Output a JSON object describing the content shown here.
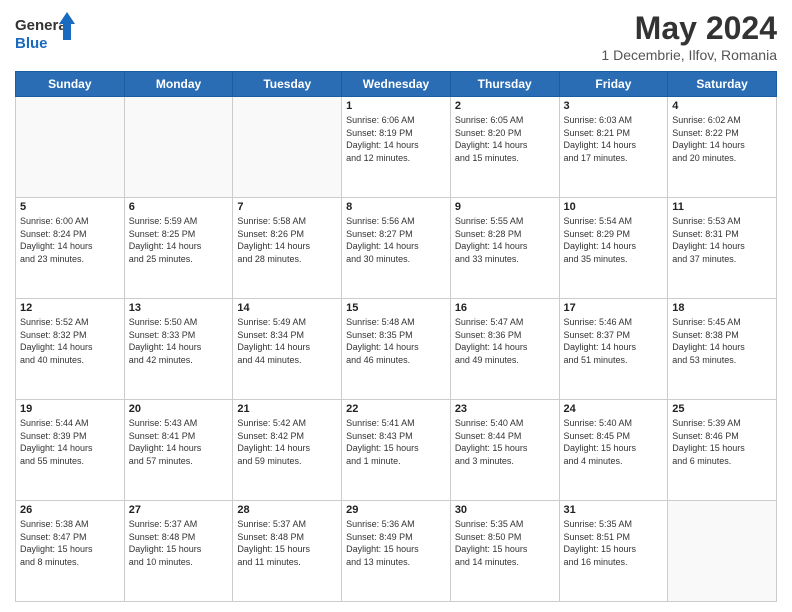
{
  "logo": {
    "line1": "General",
    "line2": "Blue"
  },
  "title": "May 2024",
  "subtitle": "1 Decembrie, Ilfov, Romania",
  "weekdays": [
    "Sunday",
    "Monday",
    "Tuesday",
    "Wednesday",
    "Thursday",
    "Friday",
    "Saturday"
  ],
  "weeks": [
    [
      {
        "day": "",
        "info": ""
      },
      {
        "day": "",
        "info": ""
      },
      {
        "day": "",
        "info": ""
      },
      {
        "day": "1",
        "info": "Sunrise: 6:06 AM\nSunset: 8:19 PM\nDaylight: 14 hours\nand 12 minutes."
      },
      {
        "day": "2",
        "info": "Sunrise: 6:05 AM\nSunset: 8:20 PM\nDaylight: 14 hours\nand 15 minutes."
      },
      {
        "day": "3",
        "info": "Sunrise: 6:03 AM\nSunset: 8:21 PM\nDaylight: 14 hours\nand 17 minutes."
      },
      {
        "day": "4",
        "info": "Sunrise: 6:02 AM\nSunset: 8:22 PM\nDaylight: 14 hours\nand 20 minutes."
      }
    ],
    [
      {
        "day": "5",
        "info": "Sunrise: 6:00 AM\nSunset: 8:24 PM\nDaylight: 14 hours\nand 23 minutes."
      },
      {
        "day": "6",
        "info": "Sunrise: 5:59 AM\nSunset: 8:25 PM\nDaylight: 14 hours\nand 25 minutes."
      },
      {
        "day": "7",
        "info": "Sunrise: 5:58 AM\nSunset: 8:26 PM\nDaylight: 14 hours\nand 28 minutes."
      },
      {
        "day": "8",
        "info": "Sunrise: 5:56 AM\nSunset: 8:27 PM\nDaylight: 14 hours\nand 30 minutes."
      },
      {
        "day": "9",
        "info": "Sunrise: 5:55 AM\nSunset: 8:28 PM\nDaylight: 14 hours\nand 33 minutes."
      },
      {
        "day": "10",
        "info": "Sunrise: 5:54 AM\nSunset: 8:29 PM\nDaylight: 14 hours\nand 35 minutes."
      },
      {
        "day": "11",
        "info": "Sunrise: 5:53 AM\nSunset: 8:31 PM\nDaylight: 14 hours\nand 37 minutes."
      }
    ],
    [
      {
        "day": "12",
        "info": "Sunrise: 5:52 AM\nSunset: 8:32 PM\nDaylight: 14 hours\nand 40 minutes."
      },
      {
        "day": "13",
        "info": "Sunrise: 5:50 AM\nSunset: 8:33 PM\nDaylight: 14 hours\nand 42 minutes."
      },
      {
        "day": "14",
        "info": "Sunrise: 5:49 AM\nSunset: 8:34 PM\nDaylight: 14 hours\nand 44 minutes."
      },
      {
        "day": "15",
        "info": "Sunrise: 5:48 AM\nSunset: 8:35 PM\nDaylight: 14 hours\nand 46 minutes."
      },
      {
        "day": "16",
        "info": "Sunrise: 5:47 AM\nSunset: 8:36 PM\nDaylight: 14 hours\nand 49 minutes."
      },
      {
        "day": "17",
        "info": "Sunrise: 5:46 AM\nSunset: 8:37 PM\nDaylight: 14 hours\nand 51 minutes."
      },
      {
        "day": "18",
        "info": "Sunrise: 5:45 AM\nSunset: 8:38 PM\nDaylight: 14 hours\nand 53 minutes."
      }
    ],
    [
      {
        "day": "19",
        "info": "Sunrise: 5:44 AM\nSunset: 8:39 PM\nDaylight: 14 hours\nand 55 minutes."
      },
      {
        "day": "20",
        "info": "Sunrise: 5:43 AM\nSunset: 8:41 PM\nDaylight: 14 hours\nand 57 minutes."
      },
      {
        "day": "21",
        "info": "Sunrise: 5:42 AM\nSunset: 8:42 PM\nDaylight: 14 hours\nand 59 minutes."
      },
      {
        "day": "22",
        "info": "Sunrise: 5:41 AM\nSunset: 8:43 PM\nDaylight: 15 hours\nand 1 minute."
      },
      {
        "day": "23",
        "info": "Sunrise: 5:40 AM\nSunset: 8:44 PM\nDaylight: 15 hours\nand 3 minutes."
      },
      {
        "day": "24",
        "info": "Sunrise: 5:40 AM\nSunset: 8:45 PM\nDaylight: 15 hours\nand 4 minutes."
      },
      {
        "day": "25",
        "info": "Sunrise: 5:39 AM\nSunset: 8:46 PM\nDaylight: 15 hours\nand 6 minutes."
      }
    ],
    [
      {
        "day": "26",
        "info": "Sunrise: 5:38 AM\nSunset: 8:47 PM\nDaylight: 15 hours\nand 8 minutes."
      },
      {
        "day": "27",
        "info": "Sunrise: 5:37 AM\nSunset: 8:48 PM\nDaylight: 15 hours\nand 10 minutes."
      },
      {
        "day": "28",
        "info": "Sunrise: 5:37 AM\nSunset: 8:48 PM\nDaylight: 15 hours\nand 11 minutes."
      },
      {
        "day": "29",
        "info": "Sunrise: 5:36 AM\nSunset: 8:49 PM\nDaylight: 15 hours\nand 13 minutes."
      },
      {
        "day": "30",
        "info": "Sunrise: 5:35 AM\nSunset: 8:50 PM\nDaylight: 15 hours\nand 14 minutes."
      },
      {
        "day": "31",
        "info": "Sunrise: 5:35 AM\nSunset: 8:51 PM\nDaylight: 15 hours\nand 16 minutes."
      },
      {
        "day": "",
        "info": ""
      }
    ]
  ]
}
